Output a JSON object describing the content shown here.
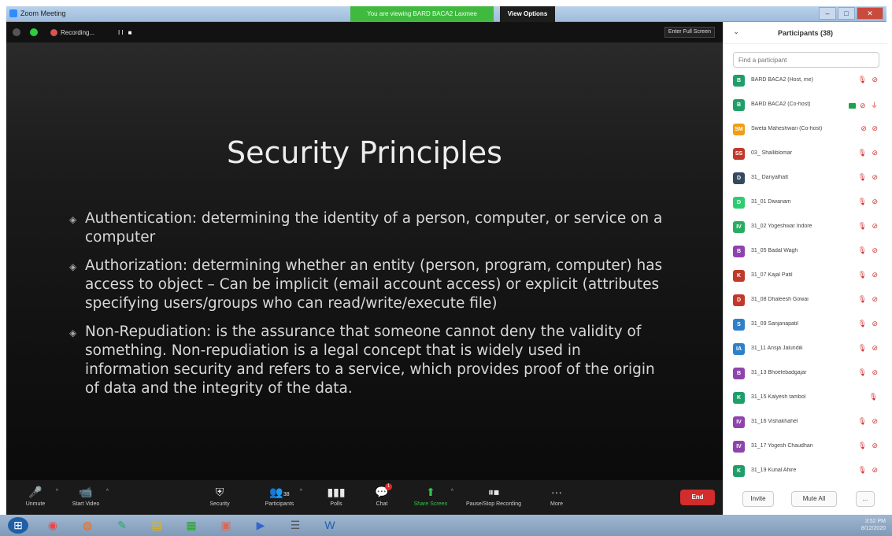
{
  "window": {
    "title": "Zoom Meeting",
    "viewing_banner": "You are viewing BARD BACA2 Laxmee",
    "view_options": "View Options",
    "minimize": "–",
    "maximize": "□",
    "close": "✕"
  },
  "meeting_top": {
    "recording": "Recording...",
    "pause_stop": "II ■",
    "fullscreen": "Enter Full Screen"
  },
  "slide": {
    "title": "Security Principles",
    "bullets": [
      "Authentication: determining the identity of a person, computer, or service on a computer",
      "Authorization: determining whether an entity (person, program, computer) has access to object – Can be implicit (email account access) or explicit (attributes specifying users/groups who can read/write/execute file)",
      "Non-Repudiation: is the assurance that someone cannot deny the validity of something. Non-repudiation is a legal concept that is widely used in information security and refers to a service, which provides proof of the origin of data and the integrity of the data."
    ]
  },
  "controls": {
    "unmute": "Unmute",
    "start_video": "Start Video",
    "security": "Security",
    "participants": "Participants",
    "participants_count": "38",
    "polls": "Polls",
    "chat": "Chat",
    "chat_badge": "1",
    "share_screen": "Share Screen",
    "record": "Pause/Stop Recording",
    "more": "More",
    "end": "End"
  },
  "panel": {
    "title": "Participants (38)",
    "search_placeholder": "Find a participant",
    "participants": [
      {
        "initials": "B",
        "name": "BARD BACA2 (Host, me)",
        "color": "#1f9e6a",
        "icons": "🎙 ⊘"
      },
      {
        "initials": "B",
        "name": "BARD BACA2 (Co-host)",
        "color": "#1f9e6a",
        "icons": "⊘ ⏚",
        "video": true
      },
      {
        "initials": "SM",
        "name": "Sweta Maheshwari (Co-host)",
        "color": "#f39c12",
        "icons": "⊘ ⊘"
      },
      {
        "initials": "SS",
        "name": "03_ Shalliblomar",
        "color": "#c0392b",
        "icons": "🎙 ⊘"
      },
      {
        "initials": "D",
        "name": "31_ Danyalhatt",
        "color": "#34495e",
        "icons": "🎙 ⊘"
      },
      {
        "initials": "D",
        "name": "31_01 Diwanam",
        "color": "#2ecc71",
        "icons": "🎙 ⊘"
      },
      {
        "initials": "IV",
        "name": "31_02 Yogeshwar Indore",
        "color": "#27ae60",
        "icons": "🎙 ⊘"
      },
      {
        "initials": "B",
        "name": "31_05 Badal Wagh",
        "color": "#8e44ad",
        "icons": "🎙 ⊘"
      },
      {
        "initials": "K",
        "name": "31_07 Kajal Patil",
        "color": "#c0392b",
        "icons": "🎙 ⊘"
      },
      {
        "initials": "D",
        "name": "31_08 Dhaleesh Gowai",
        "color": "#c0392b",
        "icons": "🎙 ⊘"
      },
      {
        "initials": "S",
        "name": "31_09 Sanjanapatil",
        "color": "#2f80c8",
        "icons": "🎙 ⊘"
      },
      {
        "initials": "IA",
        "name": "31_11 Ansja Jalundik",
        "color": "#2f80c8",
        "icons": "🎙 ⊘"
      },
      {
        "initials": "B",
        "name": "31_13 Bhoelebadgajar",
        "color": "#8e44ad",
        "icons": "🎙 ⊘"
      },
      {
        "initials": "K",
        "name": "31_15 Kalyesh tambol",
        "color": "#1f9e6a",
        "icons": "🎙"
      },
      {
        "initials": "IV",
        "name": "31_16 Vishakhahel",
        "color": "#8e44ad",
        "icons": "🎙 ⊘"
      },
      {
        "initials": "IV",
        "name": "31_17 Yogesh Chaudhari",
        "color": "#8e44ad",
        "icons": "🎙 ⊘"
      },
      {
        "initials": "K",
        "name": "31_19 Kunal Ahire",
        "color": "#1f9e6a",
        "icons": "🎙 ⊘"
      }
    ],
    "invite": "Invite",
    "mute_all": "Mute All",
    "more": "..."
  },
  "taskbar": {
    "time": "3:52 PM",
    "date": "8/12/2020"
  }
}
